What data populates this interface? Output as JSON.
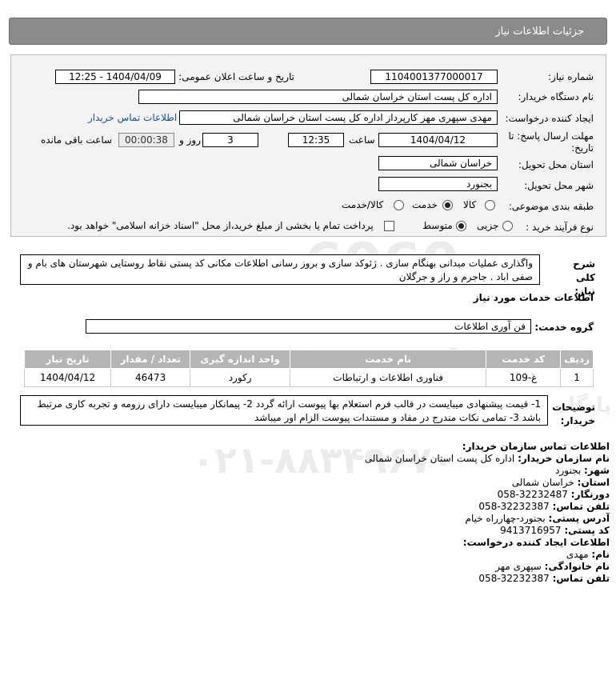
{
  "header": {
    "title": "جزئیات اطلاعات نیاز"
  },
  "form": {
    "need_number_label": "شماره نیاز:",
    "need_number": "1104001377000017",
    "announce_datetime_label": "تاریخ و ساعت اعلان عمومی:",
    "announce_datetime": "1404/04/09 - 12:25",
    "buyer_org_label": "نام دستگاه خریدار:",
    "buyer_org": "اداره کل پست استان خراسان شمالی",
    "requester_label": "ایجاد کننده درخواست:",
    "requester": "مهدی سپهری مهر کارپرداز اداره کل پست استان خراسان شمالی",
    "buyer_contact_link": "اطلاعات تماس خریدار",
    "deadline_label_line1": "مهلت ارسال پاسخ: تا",
    "deadline_label_line2": "تاریخ:",
    "deadline_date": "1404/04/12",
    "time_label": "ساعت",
    "deadline_time": "12:35",
    "days_value": "3",
    "days_label": "روز و",
    "remaining_time": "00:00:38",
    "remaining_label": "ساعت باقی مانده",
    "delivery_province_label": "استان محل تحویل:",
    "delivery_province": "خراسان شمالی",
    "delivery_city_label": "شهر محل تحویل:",
    "delivery_city": "بجنورد",
    "category_label": "طبقه بندی موضوعی:",
    "category_options": [
      "کالا",
      "خدمت",
      "کالا/خدمت"
    ],
    "process_label": "نوع فرآیند خرید :",
    "process_options": [
      "جزیی",
      "متوسط"
    ],
    "payment_note": "پرداخت تمام یا بخشی از مبلغ خرید،از محل \"اسناد خزانه اسلامی\" خواهد بود."
  },
  "summary": {
    "label": "شرح کلی نیاز:",
    "text": "واگذاری عملیات میدانی بهنگام سازی . ژئوکد سازی و بروز رسانی اطلاعات مکانی کد پستی نقاط روستایی شهرستان های بام و صفی اباد . جاجرم و راز و جرگلان"
  },
  "services": {
    "section_title": "اطلاعات خدمات مورد نیاز",
    "group_label": "گروه خدمت:",
    "group_value": "فن آوری اطلاعات",
    "columns": [
      "ردیف",
      "کد خدمت",
      "نام خدمت",
      "واحد اندازه گیری",
      "تعداد / مقدار",
      "تاریخ نیاز"
    ],
    "rows": [
      [
        "1",
        "غ-109",
        "فناوری اطلاعات و ارتباطات",
        "رکورد",
        "46473",
        "1404/04/12"
      ]
    ]
  },
  "buyer_notes": {
    "label": "توضیحات خریدار:",
    "text": "1- قیمت پیشنهادی میبایست در قالب فرم استعلام بها پیوست ارائه گردد 2- پیمانکار میبایست دارای رزومه و تجربه کاری مرتبط باشد 3- تمامی نکات مندرج در مفاد و مستندات پیوست الزام اور میباشد"
  },
  "contact": {
    "title": "اطلاعات تماس سازمان خریدار:",
    "org_label": "نام سازمان خریدار:",
    "org": "اداره کل پست استان خراسان شمالی",
    "city_label": "شهر:",
    "city": "بجنورد",
    "province_label": "استان:",
    "province": "خراسان شمالی",
    "fax_label": "دورنگار:",
    "fax": "058-32232487",
    "phone_label": "تلفن تماس:",
    "phone": "058-32232387",
    "address_label": "آدرس پستی:",
    "address": "بجنورد-چهارراه خیام",
    "postal_label": "کد پستی:",
    "postal": "9413716957",
    "creator_title": "اطلاعات ایجاد کننده درخواست:",
    "first_name_label": "نام:",
    "first_name": "مهدی",
    "last_name_label": "نام خانوادگی:",
    "last_name": "سپهری مهر",
    "creator_phone_label": "تلفن تماس:",
    "creator_phone": "058-32232387"
  },
  "watermark": {
    "brand": "ParsNamadData",
    "subtitle": "پایگاه اطلاع رسانی مناقصه و مزایده",
    "phone": "۰۲۱-۸۸۳۴۹۶۷۰"
  }
}
